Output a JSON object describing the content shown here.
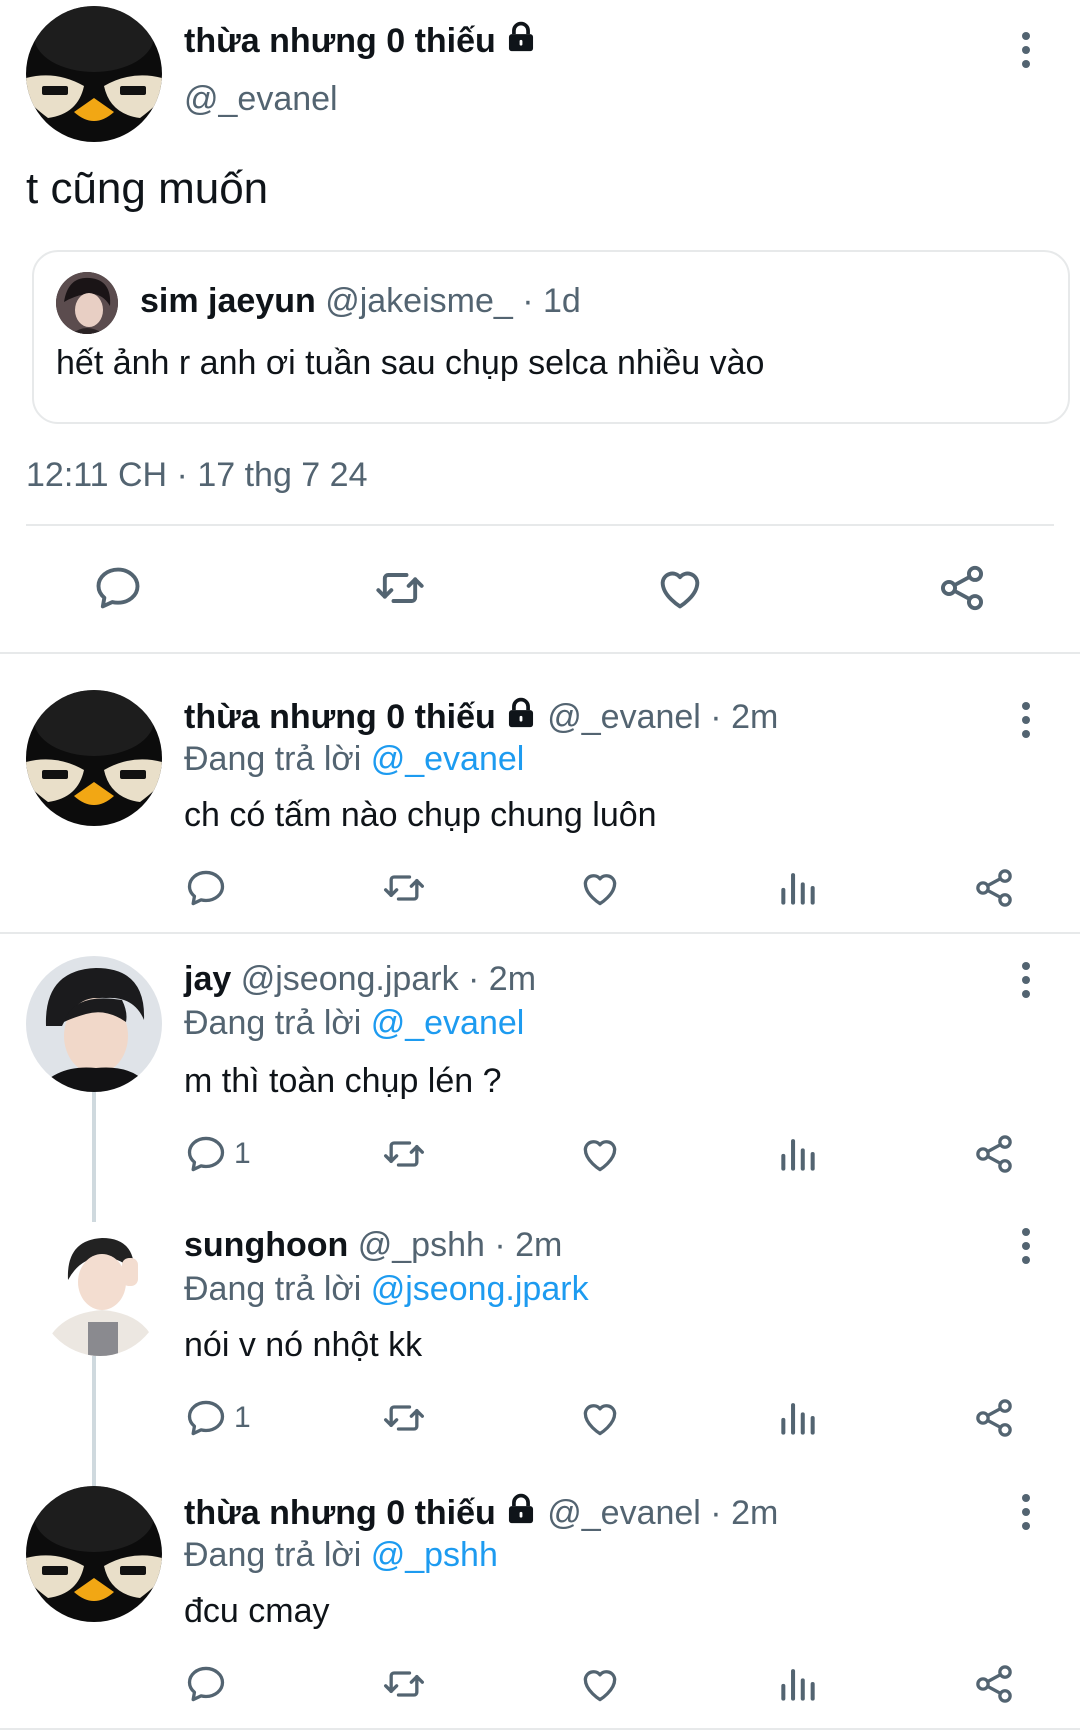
{
  "main_tweet": {
    "author_name": "thừa nhưng 0 thiếu",
    "handle": "@_evanel",
    "text": "t cũng muốn",
    "timestamp": "12:11 CH · 17 thg 7 24",
    "quote": {
      "author_name": "sim jaeyun",
      "handle_time": "@jakeisme_ · 1d",
      "text": "hết ảnh r anh ơi tuần sau chụp selca nhiều vào"
    }
  },
  "replies": [
    {
      "author_name": "thừa nhưng 0 thiếu",
      "handle_time": "@_evanel · 2m",
      "replying_label": "Đang trả lời",
      "replying_to": "@_evanel",
      "text": "ch có tấm nào chụp chung luôn",
      "reply_count": ""
    },
    {
      "author_name": "jay",
      "handle_time": "@jseong.jpark · 2m",
      "replying_label": "Đang trả lời",
      "replying_to": "@_evanel",
      "text": "m thì toàn chụp lén ?",
      "reply_count": "1"
    },
    {
      "author_name": "sunghoon",
      "handle_time": "@_pshh · 2m",
      "replying_label": "Đang trả lời",
      "replying_to": "@jseong.jpark",
      "text": "nói v nó nhột kk",
      "reply_count": "1"
    },
    {
      "author_name": "thừa nhưng 0 thiếu",
      "handle_time": "@_evanel · 2m",
      "replying_label": "Đang trả lời",
      "replying_to": "@_pshh",
      "text": "đcu cmay",
      "reply_count": ""
    }
  ],
  "icons": [
    "penguin-avatar",
    "lock-icon",
    "more-icon",
    "reply-icon",
    "retweet-icon",
    "like-icon",
    "analytics-icon",
    "share-icon"
  ],
  "colors": {
    "text": "#0f1419",
    "muted": "#536471",
    "link": "#1d9bf0",
    "divider": "#e7e9ea"
  }
}
